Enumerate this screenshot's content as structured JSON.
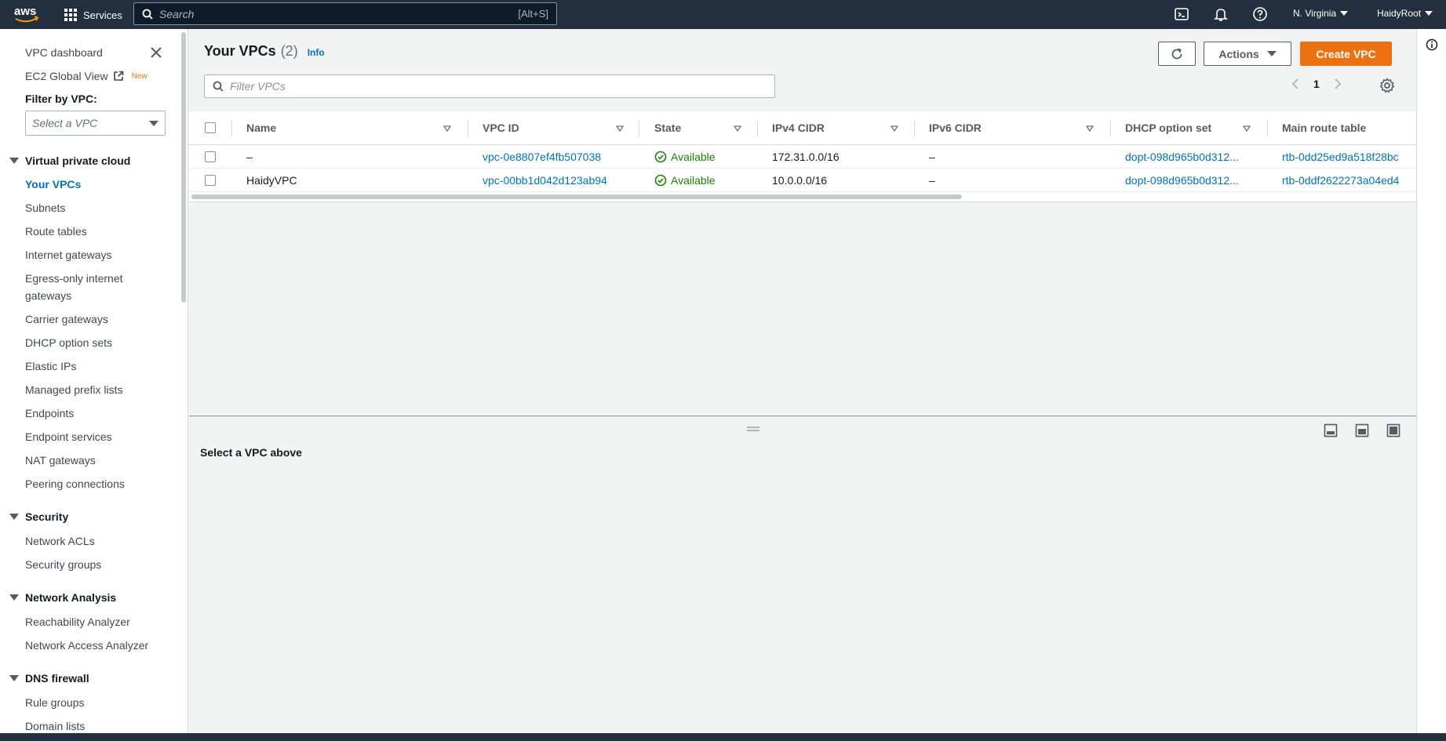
{
  "topnav": {
    "logo": "aws",
    "services_label": "Services",
    "search_placeholder": "Search",
    "search_shortcut": "[Alt+S]",
    "region": "N. Virginia",
    "user": "HaidyRoot",
    "icons": [
      "cloudshell-icon",
      "bell-icon",
      "help-icon"
    ]
  },
  "sidebar": {
    "dashboard": "VPC dashboard",
    "global_view": "EC2 Global View",
    "new_badge": "New",
    "filter_label": "Filter by VPC:",
    "filter_placeholder": "Select a VPC",
    "sections": [
      {
        "title": "Virtual private cloud",
        "items": [
          "Your VPCs",
          "Subnets",
          "Route tables",
          "Internet gateways",
          "Egress-only internet",
          "gateways",
          "Carrier gateways",
          "DHCP option sets",
          "Elastic IPs",
          "Managed prefix lists",
          "Endpoints",
          "Endpoint services",
          "NAT gateways",
          "Peering connections"
        ]
      },
      {
        "title": "Security",
        "items": [
          "Network ACLs",
          "Security groups"
        ]
      },
      {
        "title": "Network Analysis",
        "items": [
          "Reachability Analyzer",
          "Network Access Analyzer"
        ]
      },
      {
        "title": "DNS firewall",
        "items": [
          "Rule groups",
          "Domain lists"
        ]
      }
    ]
  },
  "main": {
    "title": "Your VPCs",
    "count": "(2)",
    "info": "Info",
    "actions_label": "Actions",
    "create_label": "Create VPC",
    "filter_placeholder": "Filter VPCs",
    "page": "1",
    "columns": [
      "Name",
      "VPC ID",
      "State",
      "IPv4 CIDR",
      "IPv6 CIDR",
      "DHCP option set",
      "Main route table"
    ],
    "rows": [
      {
        "name": "–",
        "vpc_id": "vpc-0e8807ef4fb507038",
        "state": "Available",
        "ipv4": "172.31.0.0/16",
        "ipv6": "–",
        "dhcp": "dopt-098d965b0d312...",
        "route_table": "rtb-0dd25ed9a518f28bc"
      },
      {
        "name": "HaidyVPC",
        "vpc_id": "vpc-00bb1d042d123ab94",
        "state": "Available",
        "ipv4": "10.0.0.0/16",
        "ipv6": "–",
        "dhcp": "dopt-098d965b0d312...",
        "route_table": "rtb-0ddf2622273a04ed4"
      }
    ]
  },
  "split_panel": {
    "message": "Select a VPC above"
  },
  "colors": {
    "nav_bg": "#232f3e",
    "link": "#0073bb",
    "primary": "#ec7211",
    "success": "#1d8102"
  }
}
